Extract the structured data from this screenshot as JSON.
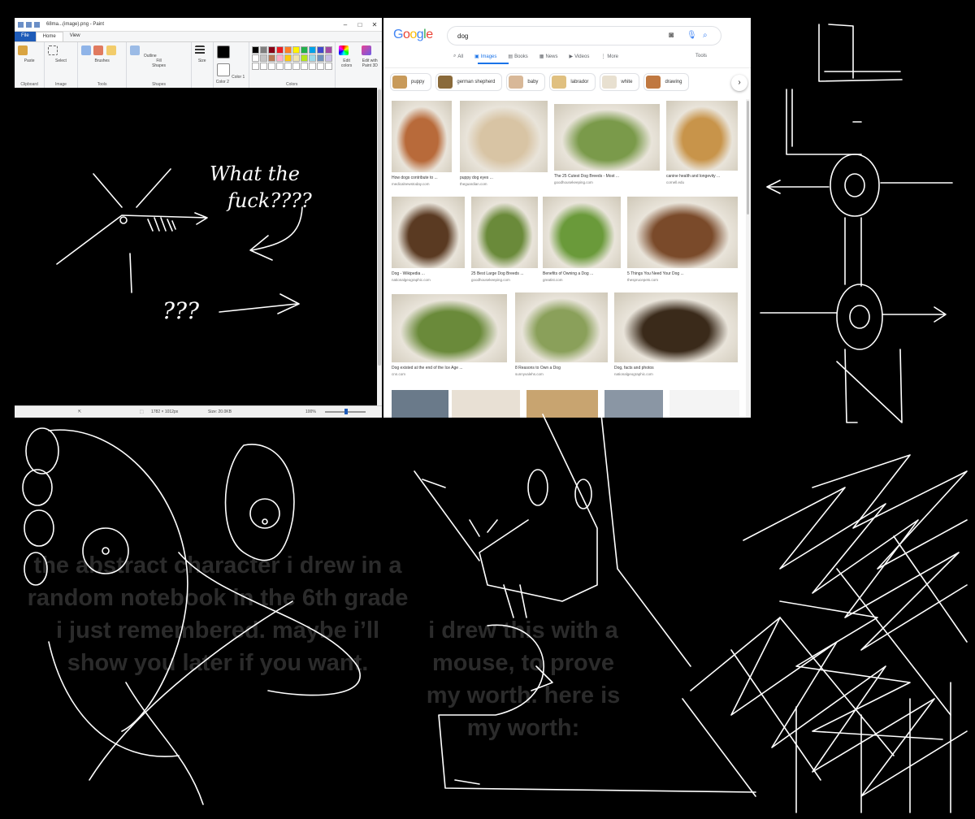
{
  "paint": {
    "title": "68ma...(image).png - Paint",
    "tabs": [
      "File",
      "Home",
      "View"
    ],
    "groups": [
      "Clipboard",
      "Image",
      "Tools",
      "Shapes",
      "Colors"
    ],
    "labels": {
      "paste": "Paste",
      "select": "Select",
      "brushes": "Brushes",
      "shapes": "Shapes",
      "size": "Size",
      "color1": "Color 1",
      "color2": "Color 2",
      "edit_colors": "Edit colors",
      "paint3d": "Edit with Paint 3D",
      "outline": "Outline",
      "fill": "Fill"
    },
    "palette": [
      "#000000",
      "#7f7f7f",
      "#880015",
      "#ed1c24",
      "#ff7f27",
      "#fff200",
      "#22b14c",
      "#00a2e8",
      "#3f48cc",
      "#a349a4",
      "#ffffff",
      "#c3c3c3",
      "#b97a57",
      "#ffaec9",
      "#ffc90e",
      "#efe4b0",
      "#b5e61d",
      "#99d9ea",
      "#7092be",
      "#c8bfe7",
      "#ffffff",
      "#ffffff",
      "#ffffff",
      "#ffffff",
      "#ffffff",
      "#ffffff",
      "#ffffff",
      "#ffffff",
      "#ffffff",
      "#ffffff"
    ],
    "status": {
      "dimensions": "1782 × 1012px",
      "size": "Size: 20.0KB",
      "zoom": "100%"
    },
    "canvas_text": {
      "line1": "What the",
      "line2": "fuck????",
      "line3": "???"
    }
  },
  "browser": {
    "logo": "Google",
    "logo_colors": [
      "#4285f4",
      "#ea4335",
      "#fbbc05",
      "#4285f4",
      "#34a853",
      "#ea4335"
    ],
    "query": "dog",
    "tabs": [
      "All",
      "Images",
      "Books",
      "News",
      "Videos",
      "More"
    ],
    "active_tab": "Images",
    "tools": "Tools",
    "chips": [
      {
        "label": "puppy",
        "color": "#c89a5a"
      },
      {
        "label": "german shepherd",
        "color": "#8a6a3a"
      },
      {
        "label": "baby",
        "color": "#d8b898"
      },
      {
        "label": "labrador",
        "color": "#e0c080"
      },
      {
        "label": "white",
        "color": "#e8e0d0"
      },
      {
        "label": "drawing",
        "color": "#c07840"
      }
    ],
    "results": [
      {
        "caption": "How dogs contribute to ...",
        "source": "medicalnewstoday.com",
        "color": "#b86a3a"
      },
      {
        "caption": "puppy dog eyes ...",
        "source": "theguardian.com",
        "color": "#d8c4a4"
      },
      {
        "caption": "The 25 Cutest Dog Breeds - Most ...",
        "source": "goodhousekeeping.com",
        "color": "#7a9a4a"
      },
      {
        "caption": "canine health and longevity ...",
        "source": "cornell.edu",
        "color": "#c8944a"
      },
      {
        "caption": "Dog - Wikipedia ...",
        "source": "nationalgeographic.com",
        "color": "#5a3a22"
      },
      {
        "caption": "25 Best Large Dog Breeds ...",
        "source": "goodhousekeeping.com",
        "color": "#6a8a3a"
      },
      {
        "caption": "Benefits of Owning a Dog ...",
        "source": "greatist.com",
        "color": "#6a9a3a"
      },
      {
        "caption": "5 Things You Need Your Dog ...",
        "source": "thesprucepets.com",
        "color": "#7a4a2a"
      },
      {
        "caption": "Dog existed at the end of the Ice Age ...",
        "source": "cnn.com",
        "color": "#6a8a3a"
      },
      {
        "caption": "8 Reasons to Own a Dog",
        "source": "sunnyvalehs.com",
        "color": "#8aa05a"
      },
      {
        "caption": "Dog, facts and photos",
        "source": "nationalgeographic.com",
        "color": "#3a2a1a"
      }
    ]
  },
  "overlay_text": {
    "left": "the abstract character i drew in a random notebook in the 6th grade i just remembered. maybe i’ll show you later if you want.",
    "middle": "i drew this with a mouse, to prove my worth. here is my worth:"
  }
}
